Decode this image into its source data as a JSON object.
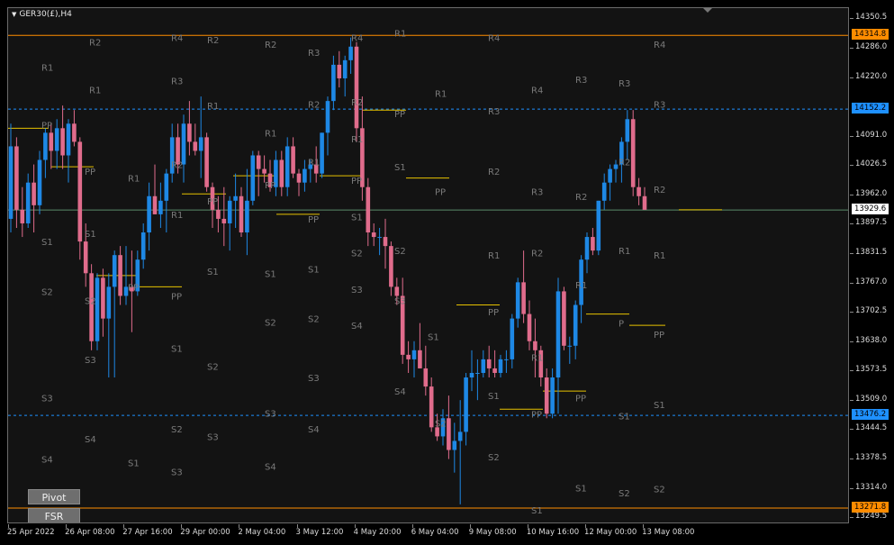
{
  "window": {
    "symbol_title": "GER30(£),H4",
    "triangle_icon": "▼"
  },
  "buttons": {
    "pivot_label": "Pivot",
    "fsr_label": "FSR"
  },
  "price_axis": {
    "ticks": [
      "14350.5",
      "14286.0",
      "14220.0",
      "14091.0",
      "14026.5",
      "13962.0",
      "13897.5",
      "13831.5",
      "13767.0",
      "13702.5",
      "13638.0",
      "13573.5",
      "13509.0",
      "13444.5",
      "13378.5",
      "13314.0",
      "13249.5"
    ],
    "tags": [
      {
        "price": 14314.8,
        "label": "14314.8",
        "color": "#ff8c00",
        "text_color": "#000000"
      },
      {
        "price": 14152.2,
        "label": "14152.2",
        "color": "#1e90ff",
        "text_color": "#000000"
      },
      {
        "price": 13929.6,
        "label": "13929.6",
        "color": "#ffffff",
        "text_color": "#000000"
      },
      {
        "price": 13476.2,
        "label": "13476.2",
        "color": "#1e90ff",
        "text_color": "#000000"
      },
      {
        "price": 13271.8,
        "label": "13271.8",
        "color": "#ff8c00",
        "text_color": "#000000"
      }
    ]
  },
  "time_axis": {
    "labels": [
      "25 Apr 2022",
      "26 Apr 08:00",
      "27 Apr 16:00",
      "29 Apr 00:00",
      "2 May 04:00",
      "3 May 12:00",
      "4 May 20:00",
      "6 May 04:00",
      "9 May 08:00",
      "10 May 16:00",
      "12 May 00:00",
      "13 May 08:00"
    ]
  },
  "colors": {
    "bull": "#1e88e5",
    "bear": "#e06c8c",
    "pivot_line": "#e6c200",
    "level_text": "#7a7a7a",
    "orange_line": "#ff8c00",
    "blue_dash": "#1e90ff",
    "current_line": "#5a8a6a"
  },
  "chart_data": {
    "type": "candlestick",
    "symbol": "GER30(£)",
    "timeframe": "H4",
    "ylim": [
      13240,
      14375
    ],
    "candles": [
      [
        13910,
        14120,
        13880,
        14070
      ],
      [
        14070,
        14090,
        13890,
        13930
      ],
      [
        13930,
        13980,
        13870,
        13900
      ],
      [
        13900,
        14010,
        13890,
        13990
      ],
      [
        13990,
        14030,
        13880,
        13940
      ],
      [
        13940,
        14060,
        13920,
        14040
      ],
      [
        14040,
        14110,
        14000,
        14100
      ],
      [
        14100,
        14120,
        14020,
        14060
      ],
      [
        14060,
        14130,
        14020,
        14110
      ],
      [
        14110,
        14160,
        14020,
        14050
      ],
      [
        14050,
        14130,
        13990,
        14120
      ],
      [
        14120,
        14150,
        14070,
        14080
      ],
      [
        14080,
        14090,
        13820,
        13860
      ],
      [
        13860,
        13900,
        13760,
        13790
      ],
      [
        13790,
        13810,
        13620,
        13640
      ],
      [
        13640,
        13790,
        13620,
        13780
      ],
      [
        13780,
        13800,
        13650,
        13690
      ],
      [
        13690,
        13790,
        13560,
        13760
      ],
      [
        13760,
        13840,
        13560,
        13830
      ],
      [
        13830,
        13850,
        13720,
        13740
      ],
      [
        13740,
        13850,
        13720,
        13760
      ],
      [
        13760,
        13840,
        13660,
        13750
      ],
      [
        13750,
        13840,
        13740,
        13820
      ],
      [
        13820,
        13900,
        13800,
        13880
      ],
      [
        13880,
        13990,
        13840,
        13960
      ],
      [
        13960,
        14030,
        13920,
        13920
      ],
      [
        13920,
        13990,
        13890,
        13950
      ],
      [
        13950,
        14020,
        13880,
        14010
      ],
      [
        14010,
        14120,
        13990,
        14090
      ],
      [
        14090,
        14120,
        14010,
        14030
      ],
      [
        14030,
        14140,
        13990,
        14120
      ],
      [
        14120,
        14170,
        14050,
        14080
      ],
      [
        14080,
        14120,
        14050,
        14060
      ],
      [
        14060,
        14180,
        14000,
        14090
      ],
      [
        14090,
        14100,
        13970,
        13980
      ],
      [
        13980,
        13990,
        13890,
        13930
      ],
      [
        13930,
        13960,
        13880,
        13910
      ],
      [
        13910,
        13980,
        13850,
        13900
      ],
      [
        13900,
        13960,
        13840,
        13950
      ],
      [
        13950,
        14010,
        13890,
        13960
      ],
      [
        13960,
        13980,
        13870,
        13880
      ],
      [
        13880,
        14020,
        13830,
        13950
      ],
      [
        13950,
        14060,
        13940,
        14050
      ],
      [
        14050,
        14060,
        13960,
        14020
      ],
      [
        14020,
        14050,
        13990,
        14010
      ],
      [
        14010,
        14040,
        13970,
        13980
      ],
      [
        13980,
        14060,
        13960,
        14040
      ],
      [
        14040,
        14060,
        13960,
        13980
      ],
      [
        13980,
        14090,
        13960,
        14070
      ],
      [
        14070,
        14090,
        14000,
        14010
      ],
      [
        14010,
        14020,
        13960,
        13990
      ],
      [
        13990,
        14040,
        13970,
        14020
      ],
      [
        14020,
        14040,
        13990,
        14030
      ],
      [
        14030,
        14070,
        13990,
        14010
      ],
      [
        14010,
        14100,
        14000,
        14100
      ],
      [
        14100,
        14180,
        14050,
        14170
      ],
      [
        14170,
        14270,
        14150,
        14250
      ],
      [
        14250,
        14280,
        14200,
        14220
      ],
      [
        14220,
        14270,
        14180,
        14260
      ],
      [
        14260,
        14310,
        14230,
        14290
      ],
      [
        14290,
        14300,
        14080,
        14110
      ],
      [
        14110,
        14180,
        13950,
        13980
      ],
      [
        13980,
        14000,
        13850,
        13880
      ],
      [
        13880,
        13900,
        13850,
        13870
      ],
      [
        13870,
        13890,
        13830,
        13870
      ],
      [
        13870,
        13910,
        13800,
        13850
      ],
      [
        13850,
        13860,
        13740,
        13760
      ],
      [
        13760,
        13780,
        13720,
        13740
      ],
      [
        13740,
        13780,
        13590,
        13610
      ],
      [
        13610,
        13640,
        13570,
        13600
      ],
      [
        13600,
        13640,
        13560,
        13620
      ],
      [
        13620,
        13680,
        13580,
        13580
      ],
      [
        13580,
        13630,
        13520,
        13540
      ],
      [
        13540,
        13560,
        13440,
        13450
      ],
      [
        13450,
        13480,
        13420,
        13430
      ],
      [
        13430,
        13490,
        13410,
        13470
      ],
      [
        13470,
        13520,
        13380,
        13400
      ],
      [
        13400,
        13460,
        13350,
        13420
      ],
      [
        13420,
        13510,
        13280,
        13440
      ],
      [
        13440,
        13570,
        13410,
        13560
      ],
      [
        13560,
        13620,
        13530,
        13570
      ],
      [
        13570,
        13600,
        13510,
        13570
      ],
      [
        13570,
        13620,
        13560,
        13600
      ],
      [
        13600,
        13630,
        13560,
        13580
      ],
      [
        13580,
        13620,
        13560,
        13570
      ],
      [
        13570,
        13610,
        13560,
        13600
      ],
      [
        13600,
        13620,
        13570,
        13600
      ],
      [
        13600,
        13700,
        13580,
        13690
      ],
      [
        13690,
        13780,
        13670,
        13770
      ],
      [
        13770,
        13840,
        13680,
        13700
      ],
      [
        13700,
        13730,
        13620,
        13640
      ],
      [
        13640,
        13690,
        13560,
        13620
      ],
      [
        13620,
        13630,
        13540,
        13560
      ],
      [
        13560,
        13580,
        13470,
        13480
      ],
      [
        13480,
        13580,
        13470,
        13560
      ],
      [
        13560,
        13780,
        13480,
        13750
      ],
      [
        13750,
        13760,
        13620,
        13630
      ],
      [
        13630,
        13650,
        13590,
        13630
      ],
      [
        13630,
        13730,
        13600,
        13720
      ],
      [
        13720,
        13830,
        13680,
        13820
      ],
      [
        13820,
        13880,
        13790,
        13870
      ],
      [
        13870,
        13890,
        13830,
        13840
      ],
      [
        13840,
        13950,
        13830,
        13950
      ],
      [
        13950,
        14010,
        13930,
        13990
      ],
      [
        13990,
        14030,
        13950,
        14020
      ],
      [
        14020,
        14040,
        13990,
        14030
      ],
      [
        14030,
        14090,
        13990,
        14080
      ],
      [
        14080,
        14150,
        14040,
        14130
      ],
      [
        14130,
        14150,
        13960,
        13980
      ],
      [
        13980,
        14000,
        13940,
        13960
      ],
      [
        13960,
        13980,
        13930,
        13930
      ]
    ],
    "pivot_levels": [
      {
        "label": "PP",
        "price": 14110,
        "x_from": 0,
        "x_to": 45
      },
      {
        "label": "PP",
        "price": 14025,
        "x_from": 48,
        "x_to": 95
      },
      {
        "label": "PP",
        "price": 13785,
        "x_from": 98,
        "x_to": 145
      },
      {
        "label": "PP",
        "price": 13760,
        "x_from": 145,
        "x_to": 193
      },
      {
        "label": "PP",
        "price": 13965,
        "x_from": 193,
        "x_to": 242
      },
      {
        "label": "PP",
        "price": 14005,
        "x_from": 250,
        "x_to": 298
      },
      {
        "label": "PP",
        "price": 13920,
        "x_from": 298,
        "x_to": 346
      },
      {
        "label": "PP",
        "price": 14005,
        "x_from": 346,
        "x_to": 393
      },
      {
        "label": "PP",
        "price": 14150,
        "x_from": 393,
        "x_to": 442
      },
      {
        "label": "PP",
        "price": 14000,
        "x_from": 442,
        "x_to": 490
      },
      {
        "label": "PP",
        "price": 13720,
        "x_from": 498,
        "x_to": 546
      },
      {
        "label": "PP",
        "price": 13490,
        "x_from": 546,
        "x_to": 594
      },
      {
        "label": "PP",
        "price": 13530,
        "x_from": 594,
        "x_to": 642
      },
      {
        "label": "PP",
        "price": 13700,
        "x_from": 642,
        "x_to": 690
      },
      {
        "label": "PP",
        "price": 13675,
        "x_from": 690,
        "x_to": 730
      },
      {
        "label": "PP",
        "price": 13930,
        "x_from": 745,
        "x_to": 793
      }
    ],
    "level_labels": [
      [
        "R2",
        90,
        14300
      ],
      [
        "R4",
        181,
        14310
      ],
      [
        "R2",
        221,
        14305
      ],
      [
        "R2",
        285,
        14295
      ],
      [
        "R3",
        333,
        14278
      ],
      [
        "R4",
        381,
        14310
      ],
      [
        "R1",
        429,
        14320
      ],
      [
        "R4",
        533,
        14310
      ],
      [
        "R4",
        717,
        14295
      ],
      [
        "R1",
        37,
        14245
      ],
      [
        "R3",
        181,
        14215
      ],
      [
        "R3",
        630,
        14218
      ],
      [
        "R3",
        678,
        14210
      ],
      [
        "R1",
        90,
        14195
      ],
      [
        "R4",
        581,
        14195
      ],
      [
        "R1",
        474,
        14187
      ],
      [
        "R2",
        333,
        14163
      ],
      [
        "R2",
        381,
        14168
      ],
      [
        "R1",
        221,
        14160
      ],
      [
        "R3",
        533,
        14148
      ],
      [
        "R3",
        717,
        14163
      ],
      [
        "PP",
        37,
        14118
      ],
      [
        "PP",
        429,
        14142
      ],
      [
        "R1",
        285,
        14100
      ],
      [
        "R1",
        381,
        14087
      ],
      [
        "R1",
        333,
        14036
      ],
      [
        "S1",
        429,
        14025
      ],
      [
        "R2",
        181,
        14030
      ],
      [
        "R2",
        678,
        14036
      ],
      [
        "R2",
        533,
        14015
      ],
      [
        "PP",
        85,
        14015
      ],
      [
        "R1",
        133,
        14000
      ],
      [
        "PP",
        381,
        13995
      ],
      [
        "PP",
        285,
        13985
      ],
      [
        "R3",
        581,
        13970
      ],
      [
        "PP",
        474,
        13970
      ],
      [
        "R2",
        630,
        13960
      ],
      [
        "R2",
        717,
        13975
      ],
      [
        "PP",
        221,
        13950
      ],
      [
        "R1",
        181,
        13920
      ],
      [
        "PP",
        333,
        13910
      ],
      [
        "S1",
        381,
        13915
      ],
      [
        "S1",
        85,
        13878
      ],
      [
        "S1",
        37,
        13860
      ],
      [
        "R1",
        678,
        13840
      ],
      [
        "S2",
        429,
        13840
      ],
      [
        "S2",
        381,
        13835
      ],
      [
        "R1",
        533,
        13830
      ],
      [
        "R2",
        581,
        13835
      ],
      [
        "R1",
        717,
        13830
      ],
      [
        "S1",
        221,
        13795
      ],
      [
        "S1",
        285,
        13790
      ],
      [
        "S1",
        333,
        13800
      ],
      [
        "PP",
        133,
        13760
      ],
      [
        "R1",
        630,
        13765
      ],
      [
        "PP",
        181,
        13740
      ],
      [
        "S2",
        37,
        13750
      ],
      [
        "S3",
        381,
        13755
      ],
      [
        "S2",
        85,
        13730
      ],
      [
        "S3",
        429,
        13730
      ],
      [
        "PP",
        533,
        13705
      ],
      [
        "S2",
        285,
        13682
      ],
      [
        "S2",
        333,
        13690
      ],
      [
        "S4",
        381,
        13675
      ],
      [
        "P",
        678,
        13680
      ],
      [
        "R1",
        581,
        13605
      ],
      [
        "S3",
        85,
        13600
      ],
      [
        "PP",
        717,
        13655
      ],
      [
        "S1",
        181,
        13625
      ],
      [
        "S1",
        466,
        13650
      ],
      [
        "S2",
        221,
        13585
      ],
      [
        "PP",
        630,
        13515
      ],
      [
        "S3",
        333,
        13560
      ],
      [
        "S4",
        429,
        13530
      ],
      [
        "S1",
        533,
        13520
      ],
      [
        "S3",
        37,
        13515
      ],
      [
        "S1",
        717,
        13500
      ],
      [
        "PP",
        581,
        13480
      ],
      [
        "S3",
        285,
        13482
      ],
      [
        "S1",
        678,
        13476
      ],
      [
        "S2",
        474,
        13460
      ],
      [
        "S2",
        181,
        13447
      ],
      [
        "S4",
        333,
        13447
      ],
      [
        "S4",
        85,
        13425
      ],
      [
        "S3",
        221,
        13430
      ],
      [
        "S2",
        533,
        13385
      ],
      [
        "S4",
        37,
        13380
      ],
      [
        "S1",
        133,
        13372
      ],
      [
        "S4",
        285,
        13364
      ],
      [
        "S3",
        181,
        13352
      ],
      [
        "S1",
        630,
        13317
      ],
      [
        "S2",
        678,
        13306
      ],
      [
        "S2",
        717,
        13315
      ],
      [
        "S1",
        581,
        13268
      ]
    ],
    "horizontal_lines": [
      {
        "price": 14314.8,
        "style": "solid",
        "color": "#ff8c00"
      },
      {
        "price": 14152.2,
        "style": "dashed",
        "color": "#1e90ff"
      },
      {
        "price": 13929.6,
        "style": "solid",
        "color": "#5a8a6a"
      },
      {
        "price": 13476.2,
        "style": "dashed",
        "color": "#1e90ff"
      },
      {
        "price": 13271.8,
        "style": "solid",
        "color": "#ff8c00"
      }
    ]
  }
}
